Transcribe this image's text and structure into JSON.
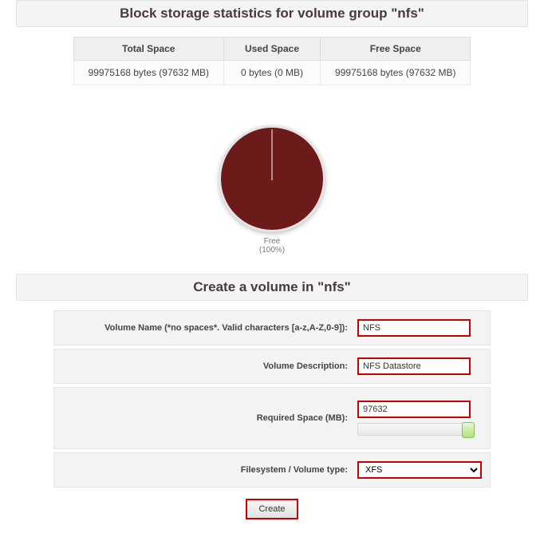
{
  "stats": {
    "heading": "Block storage statistics for volume group \"nfs\"",
    "columns": {
      "total": "Total Space",
      "used": "Used Space",
      "free": "Free Space"
    },
    "values": {
      "total": "99975168 bytes (97632 MB)",
      "used": "0 bytes (0 MB)",
      "free": "99975168 bytes (97632 MB)"
    }
  },
  "chart_data": {
    "type": "pie",
    "title": "",
    "series": [
      {
        "name": "Free",
        "value": 100
      }
    ],
    "label_line1": "Free",
    "label_line2": "(100%)"
  },
  "create": {
    "heading": "Create a volume in \"nfs\"",
    "labels": {
      "name": "Volume Name (*no spaces*. Valid characters [a-z,A-Z,0-9]):",
      "description": "Volume Description:",
      "required_space": "Required Space (MB):",
      "fs_type": "Filesystem / Volume type:"
    },
    "values": {
      "name": "NFS",
      "description": "NFS Datastore",
      "required_space": "97632",
      "fs_type": "XFS"
    },
    "button": "Create"
  }
}
